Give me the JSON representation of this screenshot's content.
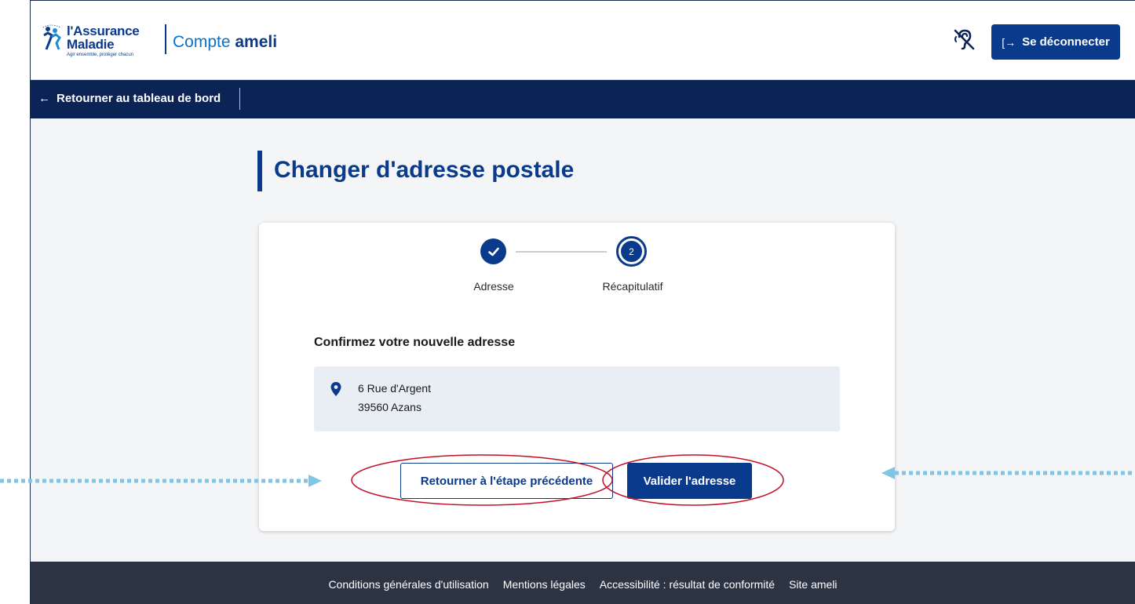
{
  "header": {
    "logo": {
      "line1": "l'Assurance",
      "line2": "Maladie",
      "tagline": "Agir ensemble, protéger chacun"
    },
    "brand_prefix": "Compte",
    "brand_name": "ameli",
    "accessibility_icon": "hearing-impaired-icon",
    "logout_label": "Se déconnecter"
  },
  "nav": {
    "back_label": "Retourner au tableau de bord"
  },
  "page": {
    "title": "Changer d'adresse postale"
  },
  "stepper": {
    "steps": [
      {
        "number": "1",
        "label": "Adresse",
        "state": "done"
      },
      {
        "number": "2",
        "label": "Récapitulatif",
        "state": "current"
      }
    ]
  },
  "confirm": {
    "heading": "Confirmez votre nouvelle adresse",
    "address_line1": "6 Rue d'Argent",
    "address_line2": "39560 Azans"
  },
  "actions": {
    "previous_label": "Retourner à l'étape précédente",
    "validate_label": "Valider l'adresse"
  },
  "footer": {
    "links": [
      "Conditions générales d'utilisation",
      "Mentions légales",
      "Accessibilité : résultat de conformité",
      "Site ameli"
    ]
  },
  "colors": {
    "primary": "#0a3a8c",
    "nav_bg": "#0c2356",
    "footer_bg": "#2c3444",
    "address_bg": "#e9edf4",
    "annotation_red": "#c0102a",
    "annotation_arrow": "#7fc6e6"
  }
}
